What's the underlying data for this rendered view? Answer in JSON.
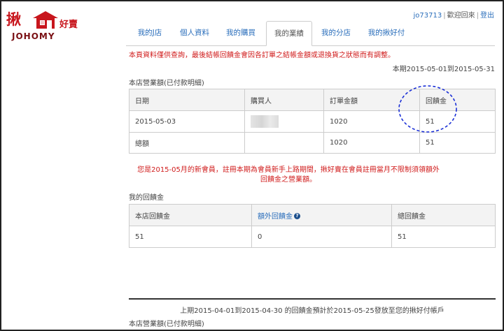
{
  "logo": {
    "main_text": "揪",
    "small_text": "好賣",
    "sub_text": "JOHOMY"
  },
  "user": {
    "username": "jo73713",
    "welcome": "歡迎回來",
    "logout": "登出"
  },
  "tabs": [
    {
      "label": "我的J店"
    },
    {
      "label": "個人資料"
    },
    {
      "label": "我的購買"
    },
    {
      "label": "我的業績"
    },
    {
      "label": "我的分店"
    },
    {
      "label": "我的揪好付"
    }
  ],
  "warning": "本頁資料僅供查詢，最後結帳回饋金會因各訂單之結帳金額或退換貨之狀態而有調整。",
  "period": "本期2015-05-01到2015-05-31",
  "sales_section": {
    "title": "本店營業額(已付款明細)",
    "headers": [
      "日期",
      "購買人",
      "訂單金額",
      "回饋金"
    ],
    "rows": [
      {
        "date": "2015-05-03",
        "amount": "1020",
        "rebate": "51"
      },
      {
        "date": "總額",
        "amount": "1020",
        "rebate": "51"
      }
    ]
  },
  "notice": "您是2015-05月的新會員，註冊本期為會員新手上路期間，揪好賣在會員註冊當月不限制須領額外回饋金之營業額。",
  "rebate_section": {
    "title": "我的回饋金",
    "headers": [
      "本店回饋金",
      "額外回饋金",
      "總回饋金"
    ],
    "values": [
      "51",
      "0",
      "51"
    ],
    "help_icon": "?"
  },
  "bottom": {
    "line": "上期2015-04-01到2015-04-30 的回饋金預計於2015-05-25發放至您的揪好付帳戶",
    "title": "本店營業額(已付款明細)"
  },
  "colors": {
    "brand_red": "#c8161d",
    "link_blue": "#2a6ebb",
    "warning_red": "#d01c1c",
    "annotation_blue": "#1a2fd6"
  }
}
